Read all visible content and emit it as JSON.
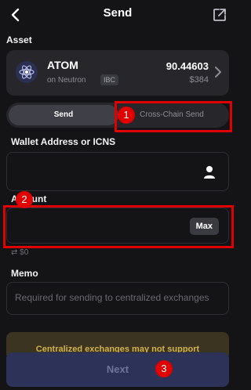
{
  "header": {
    "title": "Send",
    "back_icon": "back-arrow-icon",
    "share_icon": "external-link-icon"
  },
  "asset": {
    "section_label": "Asset",
    "symbol": "ATOM",
    "network": "on Neutron",
    "badge": "IBC",
    "amount": "90.44603",
    "fiat": "$384"
  },
  "send_mode": {
    "options": [
      "Send",
      "Cross-Chain Send"
    ],
    "selected": "Send"
  },
  "recipient": {
    "label": "Wallet Address or ICNS",
    "value": ""
  },
  "amount": {
    "label": "Amount",
    "value": "",
    "max_label": "Max",
    "fiat_equivalent": "$0"
  },
  "memo": {
    "label": "Memo",
    "placeholder": "Required for sending to centralized exchanges"
  },
  "warning": {
    "text": "Centralized exchanges may not support"
  },
  "footer": {
    "next_label": "Next"
  },
  "annotations": [
    "1",
    "2",
    "3"
  ],
  "colors": {
    "background": "#141416",
    "card": "#26262b",
    "accent_button": "#2d3358",
    "warning_text": "#d4b24a",
    "annotation": "#e00000"
  }
}
